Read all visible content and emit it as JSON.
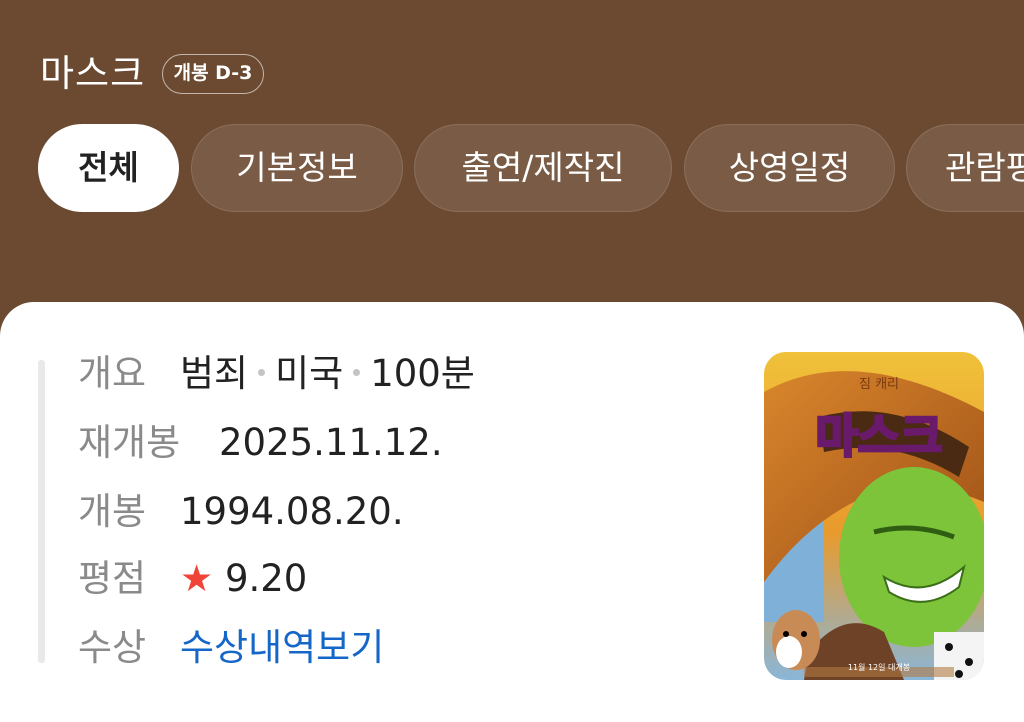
{
  "movie": {
    "title": "마스크",
    "badge": "개봉 D-3"
  },
  "tabs": [
    {
      "label": "전체",
      "active": true
    },
    {
      "label": "기본정보",
      "active": false
    },
    {
      "label": "출연/제작진",
      "active": false
    },
    {
      "label": "상영일정",
      "active": false
    },
    {
      "label": "관람평",
      "active": false
    }
  ],
  "info": {
    "overview": {
      "label": "개요",
      "genre": "범죄",
      "country": "미국",
      "runtime": "100분"
    },
    "rerelease": {
      "label": "재개봉",
      "value": "2025.11.12."
    },
    "release": {
      "label": "개봉",
      "value": "1994.08.20."
    },
    "rating": {
      "label": "평점",
      "star": "★",
      "value": "9.20"
    },
    "awards": {
      "label": "수상",
      "link": "수상내역보기"
    }
  },
  "poster": {
    "title_text": "마스크",
    "top_text": "짐 캐리",
    "bottom_text": "11월 12일 대개봉"
  },
  "colors": {
    "header_bg": "#6b4a31",
    "accent_star": "#f04438",
    "link": "#1467c8"
  }
}
